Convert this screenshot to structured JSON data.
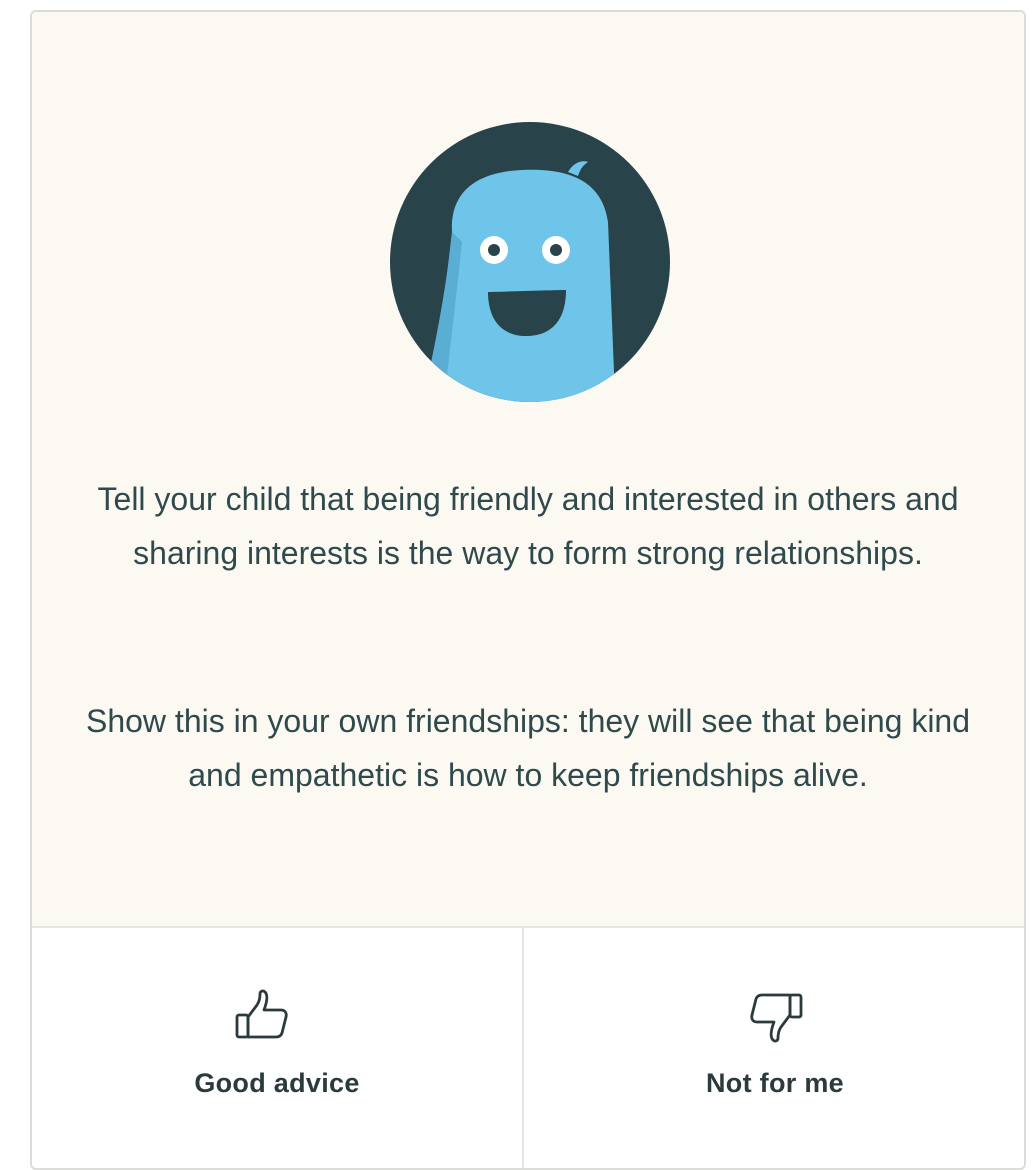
{
  "tip": {
    "paragraph_1": "Tell your child that being friendly and interested in others and sharing interests is the way to form strong relationships.",
    "paragraph_2": "Show this in your own friendships: they will see that being kind and empathetic is how to keep friendships alive."
  },
  "feedback": {
    "good_label": "Good advice",
    "good_icon": "thumbs-up-icon",
    "bad_label": "Not for me",
    "bad_icon": "thumbs-down-icon"
  },
  "colors": {
    "card_background": "#fcf9f2",
    "avatar_dark": "#28434a",
    "avatar_blue": "#6fc4e9",
    "text": "#2f4a4d"
  }
}
